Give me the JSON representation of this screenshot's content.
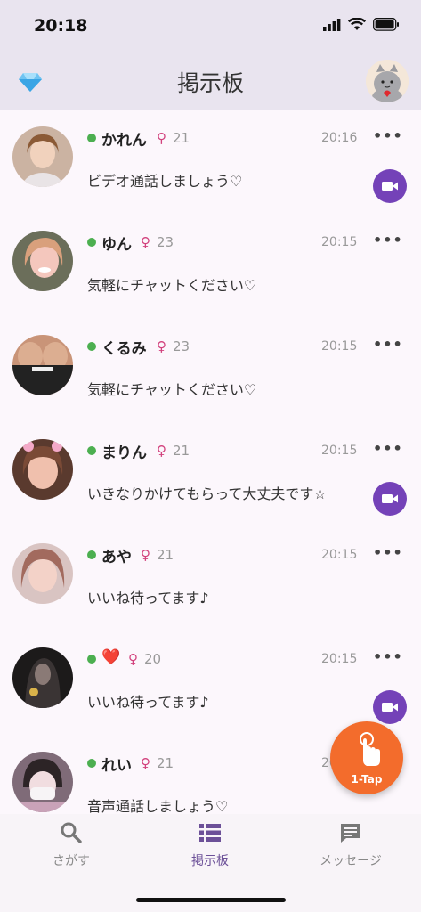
{
  "status": {
    "time": "20:18"
  },
  "header": {
    "title": "掲示板"
  },
  "posts": [
    {
      "name": "かれん",
      "gender": "♀",
      "age": "21",
      "time": "20:16",
      "message": "ビデオ通話しましょう♡",
      "video": true,
      "avatar_color": "#c9a48c"
    },
    {
      "name": "ゆん",
      "gender": "♀",
      "age": "23",
      "time": "20:15",
      "message": "気軽にチャットください♡",
      "video": false,
      "avatar_color": "#d9a09a"
    },
    {
      "name": "くるみ",
      "gender": "♀",
      "age": "23",
      "time": "20:15",
      "message": "気軽にチャットください♡",
      "video": false,
      "avatar_color": "#7a5a4a"
    },
    {
      "name": "まりん",
      "gender": "♀",
      "age": "21",
      "time": "20:15",
      "message": "いきなりかけてもらって大丈夫です☆",
      "video": true,
      "avatar_color": "#b87c72"
    },
    {
      "name": "あや",
      "gender": "♀",
      "age": "21",
      "time": "20:15",
      "message": "いいね待ってます♪",
      "video": false,
      "avatar_color": "#caa5a0"
    },
    {
      "name": "❤️",
      "gender": "♀",
      "age": "20",
      "time": "20:15",
      "message": "いいね待ってます♪",
      "video": true,
      "avatar_color": "#2e2a2a"
    },
    {
      "name": "れい",
      "gender": "♀",
      "age": "21",
      "time": "20:15",
      "message": "音声通話しましょう♡",
      "video": false,
      "avatar_color": "#b7a3ad"
    }
  ],
  "more_label": "•••",
  "fab": {
    "label": "1-Tap"
  },
  "tabs": [
    {
      "label": "さがす",
      "icon": "search-icon",
      "active": false
    },
    {
      "label": "掲示板",
      "icon": "list-icon",
      "active": true
    },
    {
      "label": "メッセージ",
      "icon": "chat-icon",
      "active": false
    }
  ],
  "colors": {
    "accent": "#7442b8",
    "online": "#4caf50",
    "fab": "#f36c2c",
    "gender": "#d2427d"
  }
}
